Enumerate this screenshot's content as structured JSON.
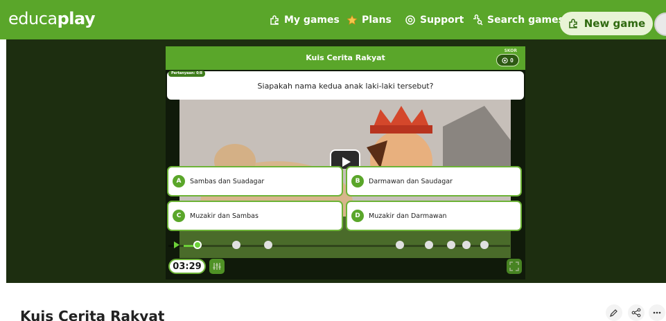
{
  "header": {
    "logo_light": "educa",
    "logo_bold": "play",
    "nav": [
      {
        "label": "My games",
        "icon": "puzzle-icon"
      },
      {
        "label": "Plans",
        "icon": "star-icon"
      },
      {
        "label": "Support",
        "icon": "lifebuoy-icon"
      },
      {
        "label": "Search games",
        "icon": "search-puzzle-icon"
      }
    ],
    "new_game": "New game"
  },
  "game": {
    "title": "Kuis Cerita Rakyat",
    "score_label": "SKOR",
    "score_value": "0",
    "question_badge": "Pertanyaan: 0/8",
    "question": "Siapakah nama kedua anak laki-laki tersebut?",
    "answers": [
      {
        "letter": "A",
        "text": "Sambas dan Suadagar"
      },
      {
        "letter": "B",
        "text": "Darmawan dan Saudagar"
      },
      {
        "letter": "C",
        "text": "Muzakir dan Sambas"
      },
      {
        "letter": "D",
        "text": "Muzakir dan Darmawan"
      }
    ],
    "timer": "03:29"
  },
  "page": {
    "title": "Kuis Cerita Rakyat"
  },
  "colors": {
    "brand_green": "#5aa62a",
    "dark_stage": "#1d2e10"
  }
}
